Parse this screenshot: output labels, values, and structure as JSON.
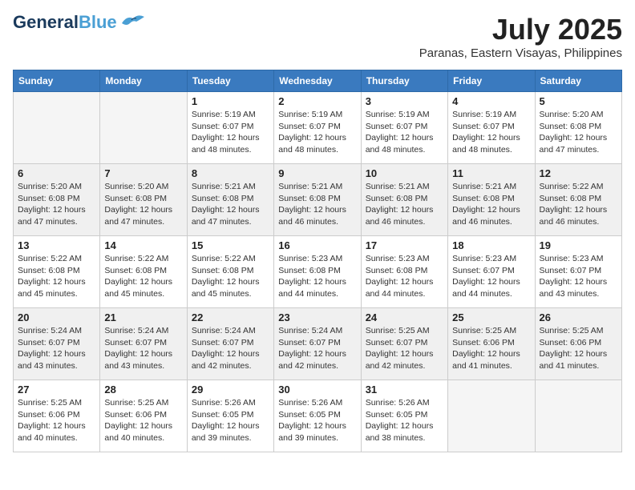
{
  "logo": {
    "line1": "General",
    "line2": "Blue",
    "bird_color": "#4a9fd4"
  },
  "header": {
    "month_year": "July 2025",
    "location": "Paranas, Eastern Visayas, Philippines"
  },
  "days_of_week": [
    "Sunday",
    "Monday",
    "Tuesday",
    "Wednesday",
    "Thursday",
    "Friday",
    "Saturday"
  ],
  "weeks": [
    [
      {
        "day": "",
        "empty": true
      },
      {
        "day": "",
        "empty": true
      },
      {
        "day": "1",
        "sunrise": "5:19 AM",
        "sunset": "6:07 PM",
        "daylight": "12 hours and 48 minutes."
      },
      {
        "day": "2",
        "sunrise": "5:19 AM",
        "sunset": "6:07 PM",
        "daylight": "12 hours and 48 minutes."
      },
      {
        "day": "3",
        "sunrise": "5:19 AM",
        "sunset": "6:07 PM",
        "daylight": "12 hours and 48 minutes."
      },
      {
        "day": "4",
        "sunrise": "5:19 AM",
        "sunset": "6:07 PM",
        "daylight": "12 hours and 48 minutes."
      },
      {
        "day": "5",
        "sunrise": "5:20 AM",
        "sunset": "6:08 PM",
        "daylight": "12 hours and 47 minutes."
      }
    ],
    [
      {
        "day": "6",
        "sunrise": "5:20 AM",
        "sunset": "6:08 PM",
        "daylight": "12 hours and 47 minutes."
      },
      {
        "day": "7",
        "sunrise": "5:20 AM",
        "sunset": "6:08 PM",
        "daylight": "12 hours and 47 minutes."
      },
      {
        "day": "8",
        "sunrise": "5:21 AM",
        "sunset": "6:08 PM",
        "daylight": "12 hours and 47 minutes."
      },
      {
        "day": "9",
        "sunrise": "5:21 AM",
        "sunset": "6:08 PM",
        "daylight": "12 hours and 46 minutes."
      },
      {
        "day": "10",
        "sunrise": "5:21 AM",
        "sunset": "6:08 PM",
        "daylight": "12 hours and 46 minutes."
      },
      {
        "day": "11",
        "sunrise": "5:21 AM",
        "sunset": "6:08 PM",
        "daylight": "12 hours and 46 minutes."
      },
      {
        "day": "12",
        "sunrise": "5:22 AM",
        "sunset": "6:08 PM",
        "daylight": "12 hours and 46 minutes."
      }
    ],
    [
      {
        "day": "13",
        "sunrise": "5:22 AM",
        "sunset": "6:08 PM",
        "daylight": "12 hours and 45 minutes."
      },
      {
        "day": "14",
        "sunrise": "5:22 AM",
        "sunset": "6:08 PM",
        "daylight": "12 hours and 45 minutes."
      },
      {
        "day": "15",
        "sunrise": "5:22 AM",
        "sunset": "6:08 PM",
        "daylight": "12 hours and 45 minutes."
      },
      {
        "day": "16",
        "sunrise": "5:23 AM",
        "sunset": "6:08 PM",
        "daylight": "12 hours and 44 minutes."
      },
      {
        "day": "17",
        "sunrise": "5:23 AM",
        "sunset": "6:08 PM",
        "daylight": "12 hours and 44 minutes."
      },
      {
        "day": "18",
        "sunrise": "5:23 AM",
        "sunset": "6:07 PM",
        "daylight": "12 hours and 44 minutes."
      },
      {
        "day": "19",
        "sunrise": "5:23 AM",
        "sunset": "6:07 PM",
        "daylight": "12 hours and 43 minutes."
      }
    ],
    [
      {
        "day": "20",
        "sunrise": "5:24 AM",
        "sunset": "6:07 PM",
        "daylight": "12 hours and 43 minutes."
      },
      {
        "day": "21",
        "sunrise": "5:24 AM",
        "sunset": "6:07 PM",
        "daylight": "12 hours and 43 minutes."
      },
      {
        "day": "22",
        "sunrise": "5:24 AM",
        "sunset": "6:07 PM",
        "daylight": "12 hours and 42 minutes."
      },
      {
        "day": "23",
        "sunrise": "5:24 AM",
        "sunset": "6:07 PM",
        "daylight": "12 hours and 42 minutes."
      },
      {
        "day": "24",
        "sunrise": "5:25 AM",
        "sunset": "6:07 PM",
        "daylight": "12 hours and 42 minutes."
      },
      {
        "day": "25",
        "sunrise": "5:25 AM",
        "sunset": "6:06 PM",
        "daylight": "12 hours and 41 minutes."
      },
      {
        "day": "26",
        "sunrise": "5:25 AM",
        "sunset": "6:06 PM",
        "daylight": "12 hours and 41 minutes."
      }
    ],
    [
      {
        "day": "27",
        "sunrise": "5:25 AM",
        "sunset": "6:06 PM",
        "daylight": "12 hours and 40 minutes."
      },
      {
        "day": "28",
        "sunrise": "5:25 AM",
        "sunset": "6:06 PM",
        "daylight": "12 hours and 40 minutes."
      },
      {
        "day": "29",
        "sunrise": "5:26 AM",
        "sunset": "6:05 PM",
        "daylight": "12 hours and 39 minutes."
      },
      {
        "day": "30",
        "sunrise": "5:26 AM",
        "sunset": "6:05 PM",
        "daylight": "12 hours and 39 minutes."
      },
      {
        "day": "31",
        "sunrise": "5:26 AM",
        "sunset": "6:05 PM",
        "daylight": "12 hours and 38 minutes."
      },
      {
        "day": "",
        "empty": true
      },
      {
        "day": "",
        "empty": true
      }
    ]
  ],
  "labels": {
    "sunrise_prefix": "Sunrise: ",
    "sunset_prefix": "Sunset: ",
    "daylight_label": "Daylight: "
  }
}
